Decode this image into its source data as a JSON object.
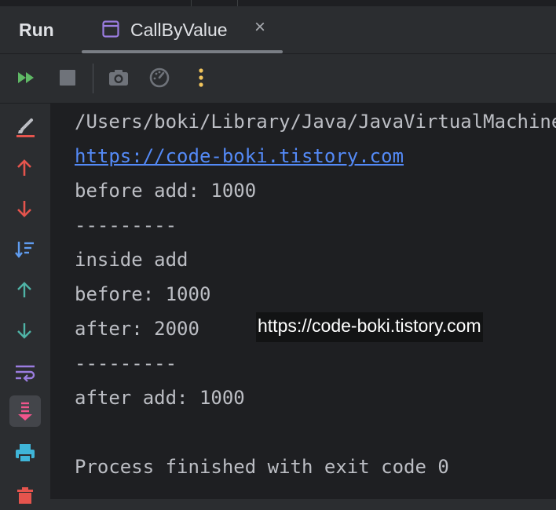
{
  "tool_window": {
    "title": "Run",
    "tab": {
      "label": "CallByValue",
      "icon": "application-window-icon",
      "close": "×"
    }
  },
  "toolbar": {
    "buttons": [
      {
        "name": "rerun-icon",
        "color": "#5fb865"
      },
      {
        "name": "stop-icon",
        "color": "#6f737a"
      },
      {
        "name": "camera-icon",
        "color": "#6f737a"
      },
      {
        "name": "gauge-icon",
        "color": "#6f737a"
      },
      {
        "name": "more-options-icon",
        "color": "#f2c55c"
      }
    ]
  },
  "gutter": {
    "buttons": [
      "clear-all-icon",
      "arrow-up-icon",
      "arrow-down-icon",
      "sort-lines-icon",
      "previous-occurrence-icon",
      "next-occurrence-icon",
      "soft-wrap-icon",
      "scroll-to-end-icon",
      "print-icon",
      "trash-icon"
    ]
  },
  "console": {
    "lines": [
      "/Users/boki/Library/Java/JavaVirtualMachines",
      "https://code-boki.tistory.com",
      "before add: 1000",
      "---------",
      "inside add",
      "before: 1000",
      "after: 2000",
      "---------",
      "after add: 1000",
      "",
      "Process finished with exit code 0"
    ]
  },
  "watermark": "https://code-boki.tistory.com",
  "colors": {
    "background": "#2b2d30",
    "console_background": "#1e1f22",
    "console_text": "#bcbec4",
    "link": "#548af7",
    "accent_red": "#e5544d",
    "accent_green": "#5fb865",
    "accent_teal": "#4fb3a6",
    "accent_purple": "#9b7de0",
    "accent_pink": "#f0558c"
  }
}
